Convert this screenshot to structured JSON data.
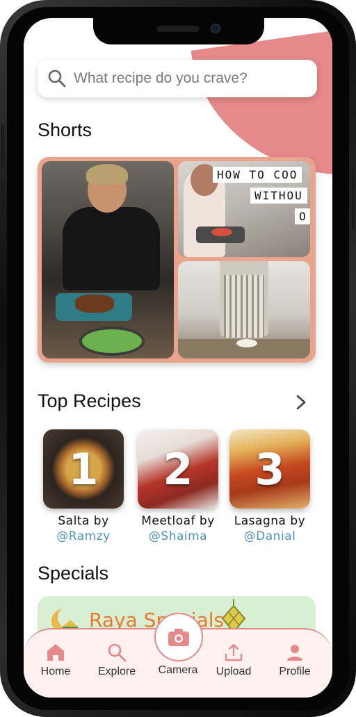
{
  "search": {
    "placeholder": "What recipe do you crave?"
  },
  "sections": {
    "shorts": "Shorts",
    "top_recipes": "Top Recipes",
    "specials": "Specials"
  },
  "shorts": {
    "overlay_lines": [
      "HOW TO COO",
      "WITHOU",
      "O"
    ]
  },
  "top_recipes": [
    {
      "rank": "1",
      "title": "Salta by",
      "author": "@Ramzy"
    },
    {
      "rank": "2",
      "title": "Meetloaf by",
      "author": "@Shaima"
    },
    {
      "rank": "3",
      "title": "Lasagna by",
      "author": "@Danial"
    }
  ],
  "specials_banner": {
    "text": "Raya Specials"
  },
  "nav": {
    "items": [
      {
        "label": "Home",
        "icon": "home-icon"
      },
      {
        "label": "Explore",
        "icon": "search-icon"
      },
      {
        "label": "Camera",
        "icon": "camera-icon"
      },
      {
        "label": "Upload",
        "icon": "upload-icon"
      },
      {
        "label": "Profile",
        "icon": "profile-icon"
      }
    ]
  },
  "colors": {
    "accent": "#e6898a",
    "shorts_frame": "#e8a48c",
    "author_link": "#4b93b8",
    "specials_bg": "#d8efd3",
    "specials_text": "#e87a2d"
  }
}
